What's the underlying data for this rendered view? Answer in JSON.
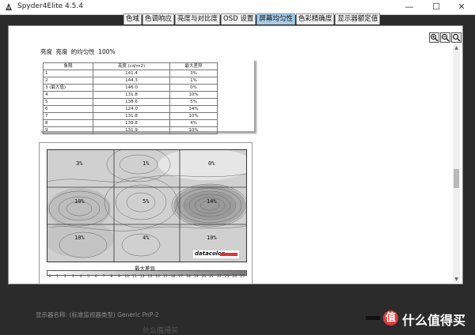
{
  "window": {
    "title": "Spyder4Elite 4.5.4",
    "minimize": "—",
    "maximize": "☐",
    "close": "✕"
  },
  "tabs": [
    "色域",
    "色调响应",
    "亮度与对比度",
    "OSD 设置",
    "屏幕均匀性",
    "色彩精确度",
    "显示器额定值"
  ],
  "active_tab": "屏幕均匀性",
  "report": {
    "heading": [
      "亮度",
      "亮度",
      "的均匀性",
      "100%"
    ],
    "columns": [
      "象限",
      "亮度 (cd/m2)",
      "最大差异"
    ],
    "rows": [
      [
        "1",
        "141.4",
        "3%"
      ],
      [
        "2",
        "144.3",
        "1%"
      ],
      [
        "3 (最大值)",
        "146.0",
        "0%"
      ],
      [
        "4",
        "131.8",
        "10%"
      ],
      [
        "5",
        "138.6",
        "5%"
      ],
      [
        "6",
        "124.0",
        "14%"
      ],
      [
        "7",
        "131.8",
        "10%"
      ],
      [
        "8",
        "139.8",
        "4%"
      ],
      [
        "9",
        "131.9",
        "10%"
      ]
    ],
    "map_labels": [
      "3%",
      "1%",
      "0%",
      "10%",
      "5%",
      "14%",
      "10%",
      "4%",
      "10%"
    ],
    "logo": "datacolor",
    "scale_title": "最大差异",
    "scale_ticks": [
      "0",
      "1",
      "2",
      "3",
      "4",
      "5",
      "6",
      "7",
      "8",
      "9",
      "10",
      "11",
      "12",
      "13",
      "14",
      "15",
      "16",
      "17",
      "18",
      "19",
      "20",
      "21",
      "22",
      "23",
      "24",
      "25"
    ]
  },
  "footer": {
    "display_label": "显示器名称: (标准监视器类型) Generic PnP-2"
  },
  "overlay": {
    "watermark": "什么值得买",
    "brand": "值 什么值得买",
    "brand_circle": "值",
    "brand_name": "什么值得买"
  }
}
